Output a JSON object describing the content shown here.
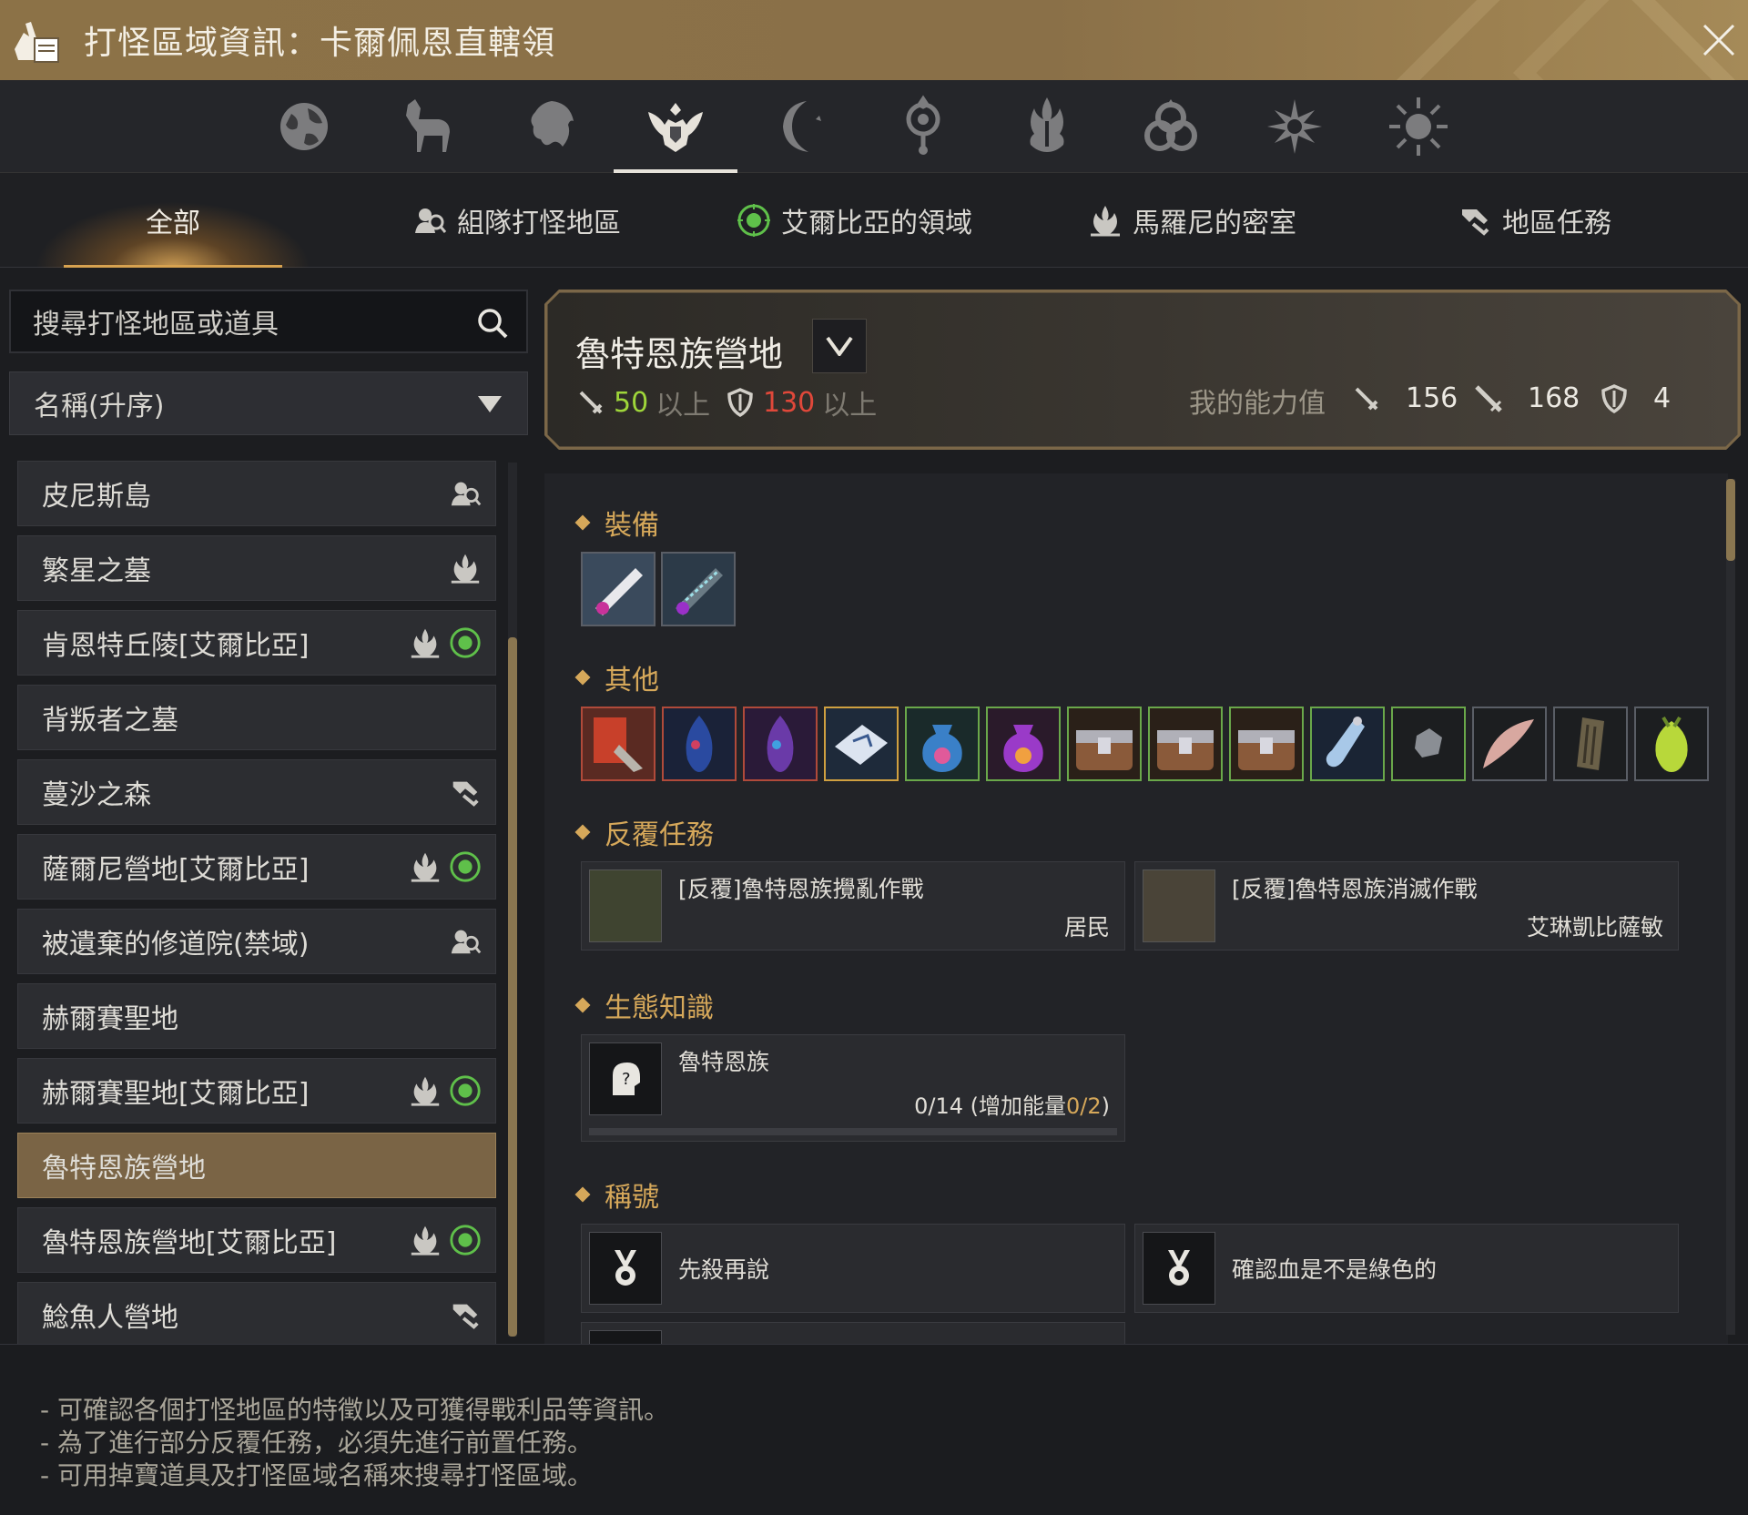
{
  "window": {
    "title": "打怪區域資訊：卡爾佩恩直轄領"
  },
  "icon_tabs": [
    {
      "icon": "globe-icon"
    },
    {
      "icon": "horse-icon"
    },
    {
      "icon": "lion-icon"
    },
    {
      "icon": "winged-crest-icon",
      "active": true
    },
    {
      "icon": "crescent-moon-icon"
    },
    {
      "icon": "orb-emblem-icon"
    },
    {
      "icon": "flame-emblem-icon"
    },
    {
      "icon": "triquetra-icon"
    },
    {
      "icon": "star-burst-icon"
    },
    {
      "icon": "sun-icon"
    }
  ],
  "category_tabs": {
    "all": "全部",
    "party": "組隊打怪地區",
    "elvia": "艾爾比亞的領域",
    "marni": "馬羅尼的密室",
    "quests": "地區任務"
  },
  "search": {
    "placeholder": "搜尋打怪地區或道具"
  },
  "sort": {
    "selected": "名稱(升序)"
  },
  "zones": [
    {
      "name": "皮尼斯島",
      "icons": [
        "party-icon"
      ]
    },
    {
      "name": "繁星之墓",
      "icons": [
        "marni-icon"
      ]
    },
    {
      "name": "肯恩特丘陵[艾爾比亞]",
      "icons": [
        "marni-icon",
        "elvia-icon"
      ]
    },
    {
      "name": "背叛者之墓",
      "icons": []
    },
    {
      "name": "蔓沙之森",
      "icons": [
        "quest-icon"
      ]
    },
    {
      "name": "薩爾尼營地[艾爾比亞]",
      "icons": [
        "marni-icon",
        "elvia-icon"
      ]
    },
    {
      "name": "被遺棄的修道院(禁域)",
      "icons": [
        "party-icon"
      ]
    },
    {
      "name": "赫爾賽聖地",
      "icons": []
    },
    {
      "name": "赫爾賽聖地[艾爾比亞]",
      "icons": [
        "marni-icon",
        "elvia-icon"
      ]
    },
    {
      "name": "魯特恩族營地",
      "icons": [],
      "selected": true
    },
    {
      "name": "魯特恩族營地[艾爾比亞]",
      "icons": [
        "marni-icon",
        "elvia-icon"
      ]
    },
    {
      "name": "鯰魚人營地",
      "icons": [
        "quest-icon"
      ]
    }
  ],
  "detail": {
    "zone_name": "魯特恩族營地",
    "req_ap": "50",
    "req_ap_suffix": "以上",
    "req_dp": "130",
    "req_dp_suffix": "以上",
    "my_stats_label": "我的能力值",
    "my_ap": "156",
    "my_aap": "168",
    "my_dp": "4",
    "colors": {
      "ap": "#9fd63a",
      "dp": "#e0483a",
      "accent": "#d6a85a"
    }
  },
  "sections": {
    "equipment": "裝備",
    "other": "其他",
    "repeat_quests": "反覆任務",
    "ecology": "生態知識",
    "titles": "稱號"
  },
  "equipment_items": [
    {
      "icon": "white-bracelet-icon"
    },
    {
      "icon": "chain-bracelet-icon"
    }
  ],
  "other_items": [
    {
      "icon": "red-scroll-icon"
    },
    {
      "icon": "blue-crystal-icon"
    },
    {
      "icon": "purple-crystal-icon"
    },
    {
      "icon": "silver-tablet-icon"
    },
    {
      "icon": "blue-pouch-icon"
    },
    {
      "icon": "purple-pouch-icon"
    },
    {
      "icon": "chest-icon"
    },
    {
      "icon": "chest-icon"
    },
    {
      "icon": "chest-icon"
    },
    {
      "icon": "potion-vial-icon"
    },
    {
      "icon": "ore-chunk-icon"
    },
    {
      "icon": "horn-icon"
    },
    {
      "icon": "bark-icon"
    },
    {
      "icon": "green-fruit-icon"
    }
  ],
  "repeat_quests": [
    {
      "title": "[反覆]魯特恩族攪亂作戰",
      "npc": "居民"
    },
    {
      "title": "[反覆]魯特恩族消滅作戰",
      "npc": "艾琳凱比薩敏"
    }
  ],
  "ecology": {
    "name": "魯特恩族",
    "progress": "0/14",
    "bonus_open": " (增加能量",
    "bonus": "0/2",
    "bonus_close": ")",
    "fill": 0
  },
  "titles": [
    {
      "name": "先殺再說"
    },
    {
      "name": "確認血是不是綠色的"
    }
  ],
  "footer_notes": [
    "- 可確認各個打怪地區的特徵以及可獲得戰利品等資訊。",
    "- 為了進行部分反覆任務，必須先進行前置任務。",
    "- 可用掉寶道具及打怪區域名稱來搜尋打怪區域。"
  ]
}
